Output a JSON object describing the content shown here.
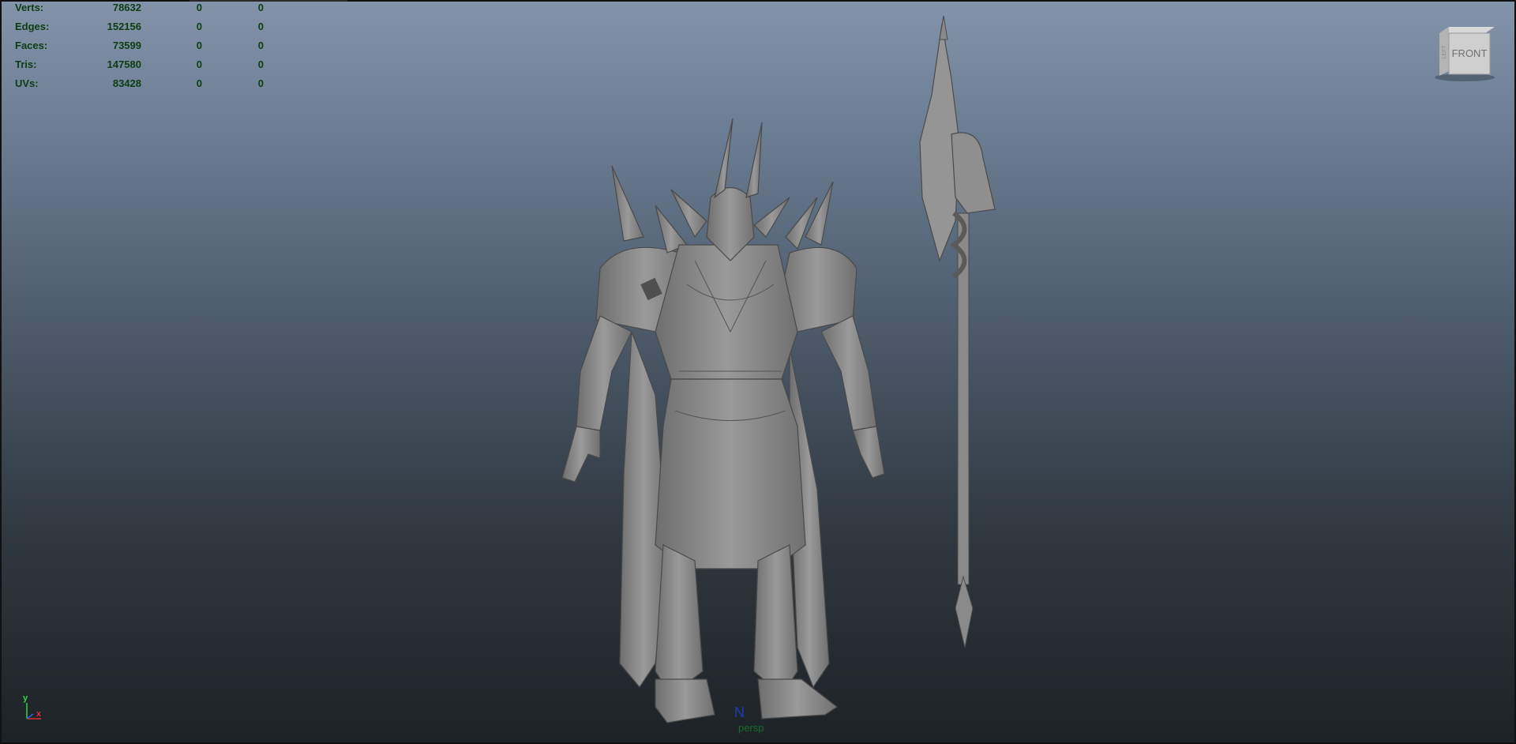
{
  "window": {
    "title": ""
  },
  "hud": {
    "rows": [
      {
        "label": "Verts:",
        "v1": "78632",
        "v2": "0",
        "v3": "0"
      },
      {
        "label": "Edges:",
        "v1": "152156",
        "v2": "0",
        "v3": "0"
      },
      {
        "label": "Faces:",
        "v1": "73599",
        "v2": "0",
        "v3": "0"
      },
      {
        "label": "Tris:",
        "v1": "147580",
        "v2": "0",
        "v3": "0"
      },
      {
        "label": "UVs:",
        "v1": "83428",
        "v2": "0",
        "v3": "0"
      }
    ]
  },
  "viewcube": {
    "front": "FRONT",
    "side": "LEFT"
  },
  "camera": {
    "name": "persp"
  },
  "axis": {
    "y": "y",
    "x": "x",
    "y_color": "#34d24a",
    "x_color": "#e03030",
    "z_color": "#3060e0"
  },
  "colors": {
    "model": "#8a8a8a",
    "model_shadow": "#5a5a5a",
    "hud_text": "#0b3d12"
  },
  "icons": {
    "model": "armored-knight-model",
    "weapon": "halberd-model",
    "nav": "viewcube-icon"
  }
}
